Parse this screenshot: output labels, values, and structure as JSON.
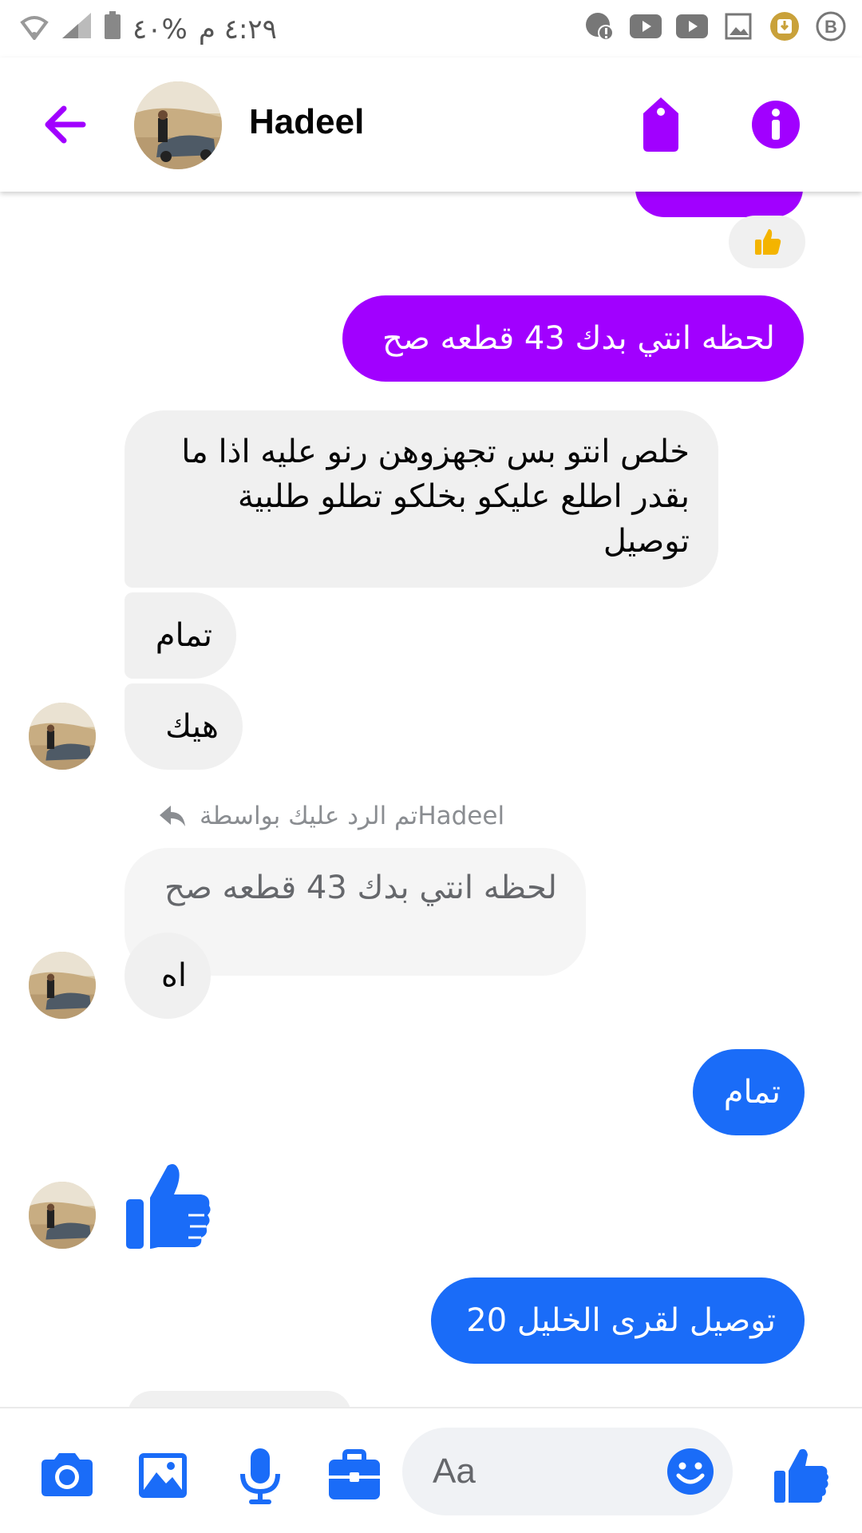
{
  "status_bar": {
    "time": "٤:٢٩ م",
    "battery": "%٤٠"
  },
  "header": {
    "contact_name": "Hadeel"
  },
  "messages": {
    "m1_text": "لحظه انتي بدك 43 قطعه صح",
    "m2_line1": "خلص انتو بس تجهزوهن رنو عليه اذا ما",
    "m2_line2": "بقدر اطلع عليكو بخلكو تطلو طلبية",
    "m2_line3": "توصيل",
    "m3_text": "تمام",
    "m4_text": "هيك",
    "reply_caption": "تم الرد عليك بواسطة",
    "reply_name": "Hadeel",
    "quoted_text": "لحظه انتي بدك 43 قطعه صح",
    "m5_text": "اه",
    "m6_text": "تمام",
    "m8_text": "توصيل لقرى الخليل 20"
  },
  "composer": {
    "placeholder": "Aa"
  },
  "colors": {
    "accent_purple": "#a100ff",
    "accent_blue": "#1a6cf8",
    "incoming_grey": "#f0f0f0"
  },
  "icons": [
    "arrow-left-icon",
    "tag-icon",
    "info-icon",
    "camera-icon",
    "image-icon",
    "microphone-icon",
    "briefcase-icon",
    "emoji-icon",
    "thumbs-up-icon"
  ]
}
